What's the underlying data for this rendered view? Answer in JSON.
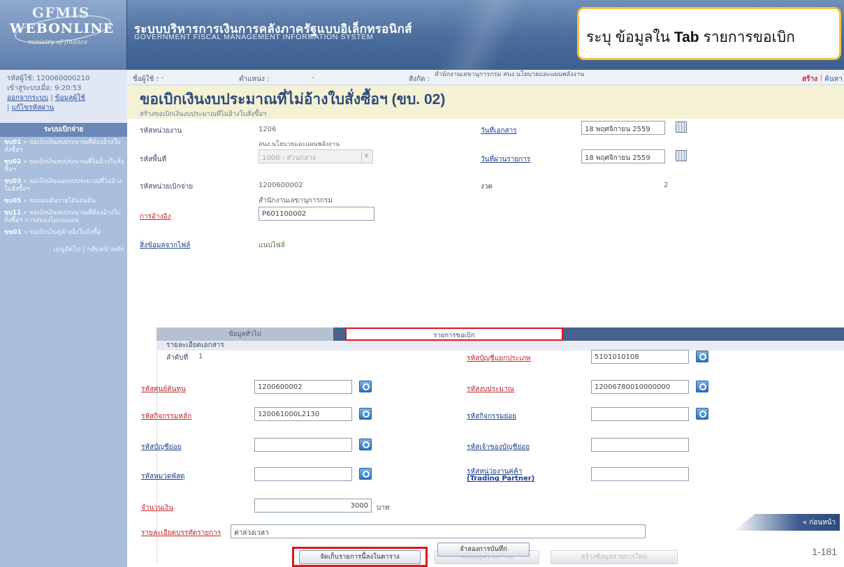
{
  "header": {
    "logo_line1": "GFMIS",
    "logo_line2": "WEBONLINE",
    "logo_line3": "ministry of finance",
    "system_name_th": "ระบบบริหารการเงินการคลังภาครัฐแบบอิเล็กทรอนิกส์",
    "system_name_en": "GOVERNMENT FISCAL MANAGEMENT INFORMATION SYSTEM"
  },
  "callout": {
    "prefix": "ระบุ ข้อมูลใน ",
    "bold": "Tab",
    "suffix": " รายการขอเบิก"
  },
  "sidebar": {
    "user_code": "รหัสผู้ใช้: 120060000210",
    "login_time": "เข้าสู่ระบบเมื่อ: 9:20:53",
    "logout_link": "ออกจากระบบ",
    "profile_link": "ข้อมูลผู้ใช้",
    "change_password_link": "แก้ไขรหัสผ่าน",
    "menu_title": "ระบบเบิกจ่าย",
    "menu_items": [
      {
        "code": "ขบ01",
        "label": " » ขอเบิกเงินงบประมาณที่ต้องอ้างใบสั่งซื้อฯ"
      },
      {
        "code": "ขบ02",
        "label": " » ขอเบิกเงินงบประมาณที่ไม่อ้างใบสั่งซื้อฯ"
      },
      {
        "code": "ขบ03",
        "label": " » ขอเบิกเงินนอกงบประมาณที่ไม่อ้างใบสั่งซื้อฯ"
      },
      {
        "code": "ขบ05",
        "label": " » ขอถอนคืนรายได้แผ่นดิน"
      },
      {
        "code": "ขบ11",
        "label": " » ขอเบิกเงินงบประมาณที่ต้องอ้างใบสั่งซื้อฯ การสนองไม่แน่นอน"
      },
      {
        "code": "ขข01",
        "label": " » ขอเบิกเงินคู่ค้างอิงใบสั่งซื้อ"
      }
    ],
    "bottom_links": "เมนูถัดไป | กลับหน้าหลัก"
  },
  "userbar": {
    "user_label": "ชื่อผู้ใช้ :",
    "user_value": "- -",
    "position_label": "ตำแหน่ง :",
    "position_value": "-",
    "affiliation_label": "สังกัด :",
    "affiliation_value": "สำนักงานเลขานุการกรม สนง.นโยบายและแผนพลังงาน",
    "action_create": "สร้าง",
    "action_search": "ค้นหา"
  },
  "page": {
    "title": "ขอเบิกเงินงบประมาณที่ไม่อ้างใบสั่งซื้อฯ (ขบ. 02)",
    "subtitle": "สร้างขอเบิกเงินงบประมาณที่ไม่อ้างใบสั่งซื้อฯ"
  },
  "form": {
    "dept_code_label": "รหัสหน่วยงาน",
    "dept_code_value": "1206",
    "dept_name": "สนง.นโยบายและแผนพลังงาน",
    "area_code_label": "รหัสพื้นที่",
    "area_code_value": "1000 - ส่วนกลาง",
    "doc_date_label": "วันที่เอกสาร",
    "doc_date_value": "18 พฤศจิกายน 2559",
    "post_date_label": "วันที่ผ่านรายการ",
    "post_date_value": "18 พฤศจิกายน 2559",
    "disb_unit_label": "รหัสหน่วยเบิกจ่าย",
    "disb_unit_value": "1200600002",
    "disb_unit_name": "สำนักงานเลขานุการกรม",
    "period_label": "งวด",
    "period_value": "2",
    "reference_label": "การอ้างอิง",
    "reference_value": "P601100002",
    "attach_label": "สิ่งข้อมูลจากไฟล์",
    "attach_link": "แนบไฟล์"
  },
  "tabs": {
    "general": "ข้อมูลทั่วไป",
    "items": "รายการขอเบิก"
  },
  "detail": {
    "section_title": "รายละเอียดเอกสาร",
    "seq_label": "ลำดับที่",
    "seq_value": "1",
    "gl_label": "รหัสบัญชีแยกประเภท",
    "gl_value": "5101010108",
    "cost_center_label": "รหัสศูนย์ต้นทุน",
    "cost_center_value": "1200600002",
    "budget_code_label": "รหัสงบประมาณ",
    "budget_code_value": "12006780010000000",
    "main_activity_label": "รหัสกิจกรรมหลัก",
    "main_activity_value": "120061000L2130",
    "sub_activity_label": "รหัสกิจกรรมย่อย",
    "sub_activity_value": "",
    "sub_account_label": "รหัสบัญชีย่อย",
    "sub_account_value": "",
    "sub_account_owner_label": "รหัสเจ้าของบัญชีย่อย",
    "sub_account_owner_value": "",
    "material_label": "รหัสหมวดพัสดุ",
    "material_value": "",
    "trading_partner_label": "รหัสหน่วยงานคู่ค้า",
    "trading_partner_label2": "(Trading Partner)",
    "trading_partner_value": "",
    "amount_label": "จำนวนเงิน",
    "amount_value": "3000",
    "amount_unit": "บาท",
    "description_label": "รายละเอียดบรรทัดรายการ",
    "description_value": "ค่าล่วงเวลา"
  },
  "buttons": {
    "save_to_table": "จัดเก็บรายการนี้ลงในตาราง",
    "delete_item": "ลบข้อมูลรายการนี้",
    "new_item": "สร้างข้อมูลรายการใหม่",
    "back": "« ก่อนหน้า",
    "simulate_save": "จำลองการบันทึก"
  },
  "page_number": "1-181",
  "colors": {
    "accent_red": "#e0141a",
    "callout_border": "#f2c23c",
    "header_blue": "#4a6c9c",
    "title_bg": "#f4f1d4"
  }
}
